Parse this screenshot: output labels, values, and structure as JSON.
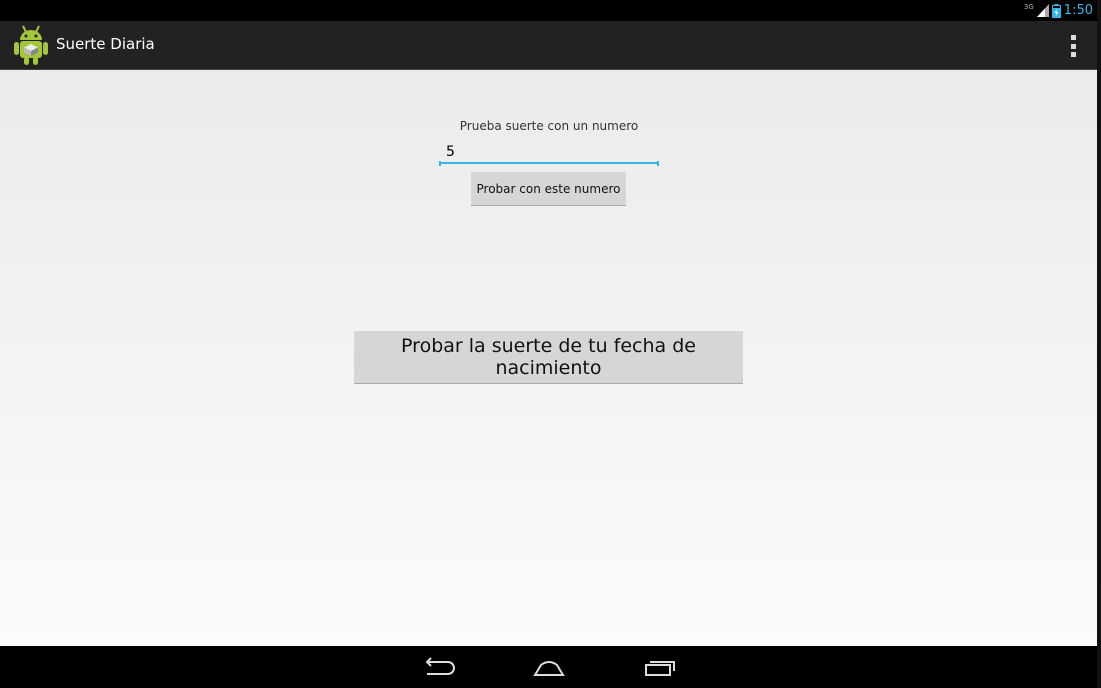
{
  "status_bar": {
    "network_type": "3G",
    "time": "1:50"
  },
  "action_bar": {
    "title": "Suerte Diaria",
    "app_icon": "android-robot-icon",
    "overflow_icon": "overflow-menu-icon"
  },
  "main": {
    "number_prompt": "Prueba suerte con un numero",
    "number_input": {
      "value": "5",
      "placeholder": ""
    },
    "try_number_button": "Probar con este numero",
    "birthdate_button": "Probar la suerte de tu fecha de nacimiento"
  },
  "nav_bar": {
    "back_icon": "back-icon",
    "home_icon": "home-icon",
    "recents_icon": "recent-apps-icon"
  },
  "colors": {
    "accent": "#33b5e5",
    "action_bar_bg": "#222222",
    "content_bg": "#efefef",
    "button_bg": "#d6d6d6",
    "android_green": "#a4c639"
  }
}
